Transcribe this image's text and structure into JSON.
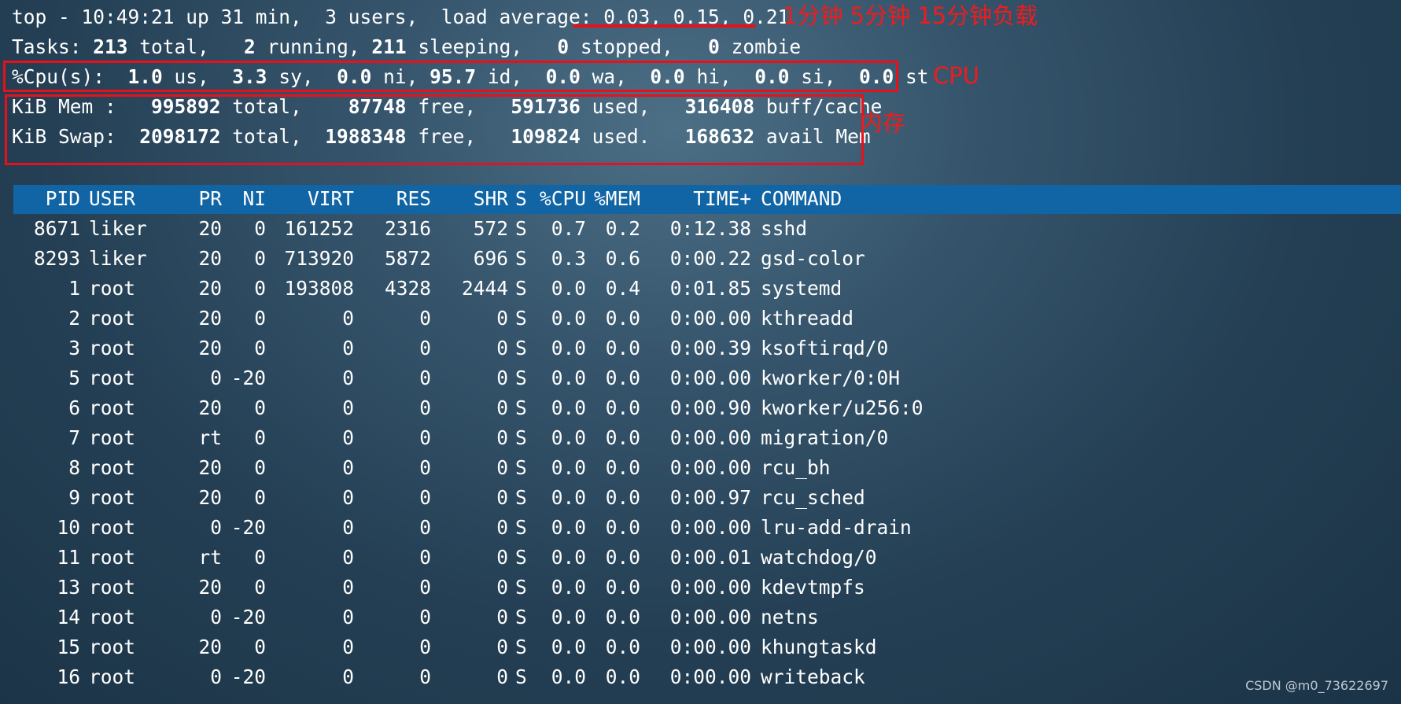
{
  "summary": {
    "line1": {
      "prefix": "top - 10:49:21 up 31 min,  3 users,  load average: ",
      "load_1": "0.03",
      "sep1": ", ",
      "load_5": "0.15",
      "sep2": ", ",
      "load_15": "0.21"
    },
    "line2": {
      "label": "Tasks: ",
      "total": "213",
      "total_lbl": " total,   ",
      "running": "2",
      "running_lbl": " running, ",
      "sleeping": "211",
      "sleeping_lbl": " sleeping,   ",
      "stopped": "0",
      "stopped_lbl": " stopped,   ",
      "zombie": "0",
      "zombie_lbl": " zombie"
    },
    "line3": {
      "label": "%Cpu(s):  ",
      "us": "1.0",
      "us_lbl": " us,  ",
      "sy": "3.3",
      "sy_lbl": " sy,  ",
      "ni": "0.0",
      "ni_lbl": " ni, ",
      "id": "95.7",
      "id_lbl": " id,  ",
      "wa": "0.0",
      "wa_lbl": " wa,  ",
      "hi": "0.0",
      "hi_lbl": " hi,  ",
      "si": "0.0",
      "si_lbl": " si,  ",
      "st": "0.0",
      "st_lbl": " st"
    },
    "line4": {
      "label": "KiB Mem :   ",
      "total": "995892",
      "total_lbl": " total,    ",
      "free": "87748",
      "free_lbl": " free,   ",
      "used": "591736",
      "used_lbl": " used,   ",
      "buff": "316408",
      "buff_lbl": " buff/cache"
    },
    "line5": {
      "label": "KiB Swap:  ",
      "total": "2098172",
      "total_lbl": " total,  ",
      "free": "1988348",
      "free_lbl": " free,   ",
      "used": "109824",
      "used_lbl": " used.   ",
      "avail": "168632",
      "avail_lbl": " avail Mem"
    }
  },
  "annotations": {
    "load": "1分钟  5分钟  15分钟负载",
    "cpu": "CPU",
    "mem": "内存"
  },
  "table": {
    "headers": [
      "PID",
      "USER",
      "PR",
      "NI",
      "VIRT",
      "RES",
      "SHR",
      "S",
      "%CPU",
      "%MEM",
      "TIME+",
      "COMMAND"
    ],
    "rows": [
      [
        "8671",
        "liker",
        "20",
        "0",
        "161252",
        "2316",
        "572",
        "S",
        "0.7",
        "0.2",
        "0:12.38",
        "sshd"
      ],
      [
        "8293",
        "liker",
        "20",
        "0",
        "713920",
        "5872",
        "696",
        "S",
        "0.3",
        "0.6",
        "0:00.22",
        "gsd-color"
      ],
      [
        "1",
        "root",
        "20",
        "0",
        "193808",
        "4328",
        "2444",
        "S",
        "0.0",
        "0.4",
        "0:01.85",
        "systemd"
      ],
      [
        "2",
        "root",
        "20",
        "0",
        "0",
        "0",
        "0",
        "S",
        "0.0",
        "0.0",
        "0:00.00",
        "kthreadd"
      ],
      [
        "3",
        "root",
        "20",
        "0",
        "0",
        "0",
        "0",
        "S",
        "0.0",
        "0.0",
        "0:00.39",
        "ksoftirqd/0"
      ],
      [
        "5",
        "root",
        "0",
        "-20",
        "0",
        "0",
        "0",
        "S",
        "0.0",
        "0.0",
        "0:00.00",
        "kworker/0:0H"
      ],
      [
        "6",
        "root",
        "20",
        "0",
        "0",
        "0",
        "0",
        "S",
        "0.0",
        "0.0",
        "0:00.90",
        "kworker/u256:0"
      ],
      [
        "7",
        "root",
        "rt",
        "0",
        "0",
        "0",
        "0",
        "S",
        "0.0",
        "0.0",
        "0:00.00",
        "migration/0"
      ],
      [
        "8",
        "root",
        "20",
        "0",
        "0",
        "0",
        "0",
        "S",
        "0.0",
        "0.0",
        "0:00.00",
        "rcu_bh"
      ],
      [
        "9",
        "root",
        "20",
        "0",
        "0",
        "0",
        "0",
        "S",
        "0.0",
        "0.0",
        "0:00.97",
        "rcu_sched"
      ],
      [
        "10",
        "root",
        "0",
        "-20",
        "0",
        "0",
        "0",
        "S",
        "0.0",
        "0.0",
        "0:00.00",
        "lru-add-drain"
      ],
      [
        "11",
        "root",
        "rt",
        "0",
        "0",
        "0",
        "0",
        "S",
        "0.0",
        "0.0",
        "0:00.01",
        "watchdog/0"
      ],
      [
        "13",
        "root",
        "20",
        "0",
        "0",
        "0",
        "0",
        "S",
        "0.0",
        "0.0",
        "0:00.00",
        "kdevtmpfs"
      ],
      [
        "14",
        "root",
        "0",
        "-20",
        "0",
        "0",
        "0",
        "S",
        "0.0",
        "0.0",
        "0:00.00",
        "netns"
      ],
      [
        "15",
        "root",
        "20",
        "0",
        "0",
        "0",
        "0",
        "S",
        "0.0",
        "0.0",
        "0:00.00",
        "khungtaskd"
      ],
      [
        "16",
        "root",
        "0",
        "-20",
        "0",
        "0",
        "0",
        "S",
        "0.0",
        "0.0",
        "0:00.00",
        "writeback"
      ]
    ]
  },
  "watermark": "CSDN @m0_73622697",
  "colors": {
    "header_bar": "#1265a5",
    "annotation": "#e8101b",
    "text": "#ffffff"
  }
}
